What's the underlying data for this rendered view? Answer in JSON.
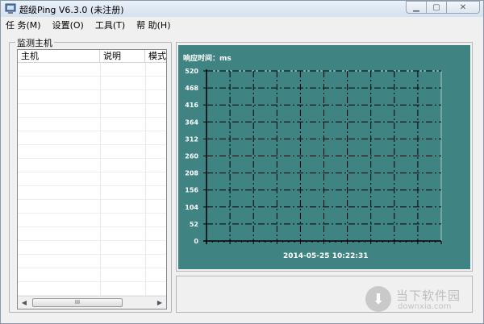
{
  "window": {
    "title": "超级Ping V6.3.0 (未注册)",
    "icon": "network-monitor-icon",
    "controls": [
      "minimize",
      "maximize",
      "close"
    ]
  },
  "menubar": [
    {
      "label": "任 务(M)"
    },
    {
      "label": "设置(O)"
    },
    {
      "label": "工具(T)"
    },
    {
      "label": "帮 助(H)"
    }
  ],
  "monitor": {
    "legend": "监测主机",
    "columns": [
      "主机",
      "说明",
      "模式"
    ],
    "rows": [],
    "scroll_thumb": "III"
  },
  "chart": {
    "ylabel": "响应时间：ms",
    "yticks": [
      "520",
      "468",
      "416",
      "364",
      "312",
      "260",
      "208",
      "156",
      "104",
      "52",
      "0"
    ],
    "timestamp": "2014-05-25  10:22:31",
    "background": "#3f8383"
  },
  "chart_data": {
    "type": "line",
    "title": "",
    "ylabel": "响应时间：ms",
    "xlabel": "2014-05-25  10:22:31",
    "ylim": [
      0,
      520
    ],
    "yticks": [
      0,
      52,
      104,
      156,
      208,
      260,
      312,
      364,
      416,
      468,
      520
    ],
    "grid": true,
    "series": []
  },
  "watermark": {
    "name": "当下软件园",
    "url": "downxia.com"
  }
}
